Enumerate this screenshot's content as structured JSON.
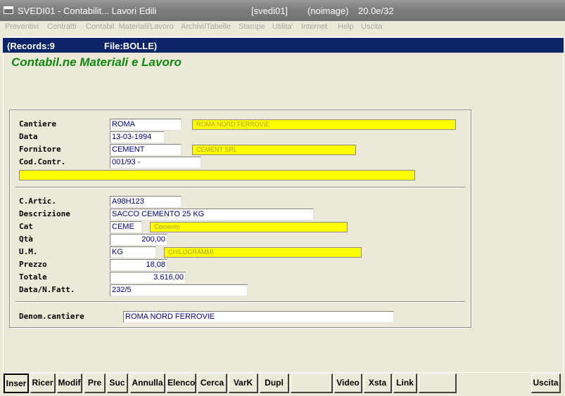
{
  "window": {
    "title": "SVEDI01 - Contabilit... Lavori Edili",
    "user": "[svedi01]",
    "image": "(noimage)",
    "version": "20.0e/32"
  },
  "menu": [
    {
      "label": "Preventivi"
    },
    {
      "label": "Contratti"
    },
    {
      "label": "Contabil. Materiali/Lavoro"
    },
    {
      "label": "Archivi/Tabelle"
    },
    {
      "label": "Stampe"
    },
    {
      "label": "Utilita'"
    },
    {
      "label": "Internet"
    },
    {
      "label": "Help"
    },
    {
      "label": "Uscita"
    }
  ],
  "status": {
    "records": "(Records:9",
    "file": "File:BOLLE)"
  },
  "app_title": "Contabil.ne Materiali e Lavoro",
  "form": {
    "cantiere": {
      "label": "Cantiere",
      "value": "ROMA",
      "desc": "ROMA NORD FERROVIE"
    },
    "data": {
      "label": "Data",
      "value": "13-03-1994"
    },
    "fornitore": {
      "label": "Fornitore",
      "value": "CEMENT",
      "desc": "CEMENT SRL"
    },
    "cod_contr": {
      "label": "Cod.Contr.",
      "value": "001/93   -",
      "desc": ""
    },
    "c_artic": {
      "label": "C.Artic.",
      "value": "A98H123"
    },
    "descrizione": {
      "label": "Descrizione",
      "value": "SACCO CEMENTO 25 KG"
    },
    "cat": {
      "label": "Cat",
      "value": "CEME",
      "desc": "Cemento"
    },
    "qta": {
      "label": "Qtà",
      "value": "200,00"
    },
    "um": {
      "label": "U.M.",
      "value": "KG",
      "desc": "CHILOGRAMMI"
    },
    "prezzo": {
      "label": "Prezzo",
      "value": "18,08"
    },
    "totale": {
      "label": "Totale",
      "value": "3.616,00"
    },
    "data_fatt": {
      "label": "Data/N.Fatt.",
      "value": "232/5"
    },
    "denom": {
      "label": "Denom.cantiere",
      "value": "ROMA NORD FERROVIE"
    }
  },
  "buttons": [
    {
      "label": "Inser"
    },
    {
      "label": "Ricer"
    },
    {
      "label": "Modif"
    },
    {
      "label": "Pre"
    },
    {
      "label": "Suc"
    },
    {
      "label": "Annulla"
    },
    {
      "label": "Elenco"
    },
    {
      "label": "Cerca"
    },
    {
      "label": "VarK"
    },
    {
      "label": "Dupl"
    },
    {
      "label": ""
    },
    {
      "label": "Video"
    },
    {
      "label": "Xsta"
    },
    {
      "label": "Link"
    },
    {
      "label": ""
    },
    {
      "label": "Uscita"
    }
  ]
}
